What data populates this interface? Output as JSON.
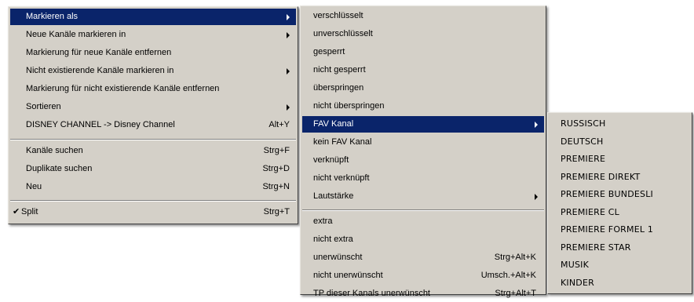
{
  "menu_main": {
    "items": [
      {
        "label": "Markieren als"
      },
      {
        "label": "Neue Kanäle markieren in"
      },
      {
        "label": "Markierung für neue Kanäle entfernen"
      },
      {
        "label": "Nicht existierende Kanäle markieren in"
      },
      {
        "label": "Markierung für nicht existierende Kanäle entfernen"
      },
      {
        "label": "Sortieren"
      },
      {
        "label": "DISNEY CHANNEL -> Disney Channel",
        "shortcut": "Alt+Y"
      },
      {
        "label": "Kanäle suchen",
        "shortcut": "Strg+F"
      },
      {
        "label": "Duplikate suchen",
        "shortcut": "Strg+D"
      },
      {
        "label": "Neu",
        "shortcut": "Strg+N"
      },
      {
        "label": "Split",
        "shortcut": "Strg+T",
        "check": "✔"
      }
    ]
  },
  "menu_markieren": {
    "items": [
      {
        "label": "verschlüsselt"
      },
      {
        "label": "unverschlüsselt"
      },
      {
        "label": "gesperrt"
      },
      {
        "label": "nicht gesperrt"
      },
      {
        "label": "überspringen"
      },
      {
        "label": "nicht überspringen"
      },
      {
        "label": "FAV Kanal"
      },
      {
        "label": "kein FAV Kanal"
      },
      {
        "label": "verknüpft"
      },
      {
        "label": "nicht verknüpft"
      },
      {
        "label": "Lautstärke"
      },
      {
        "label": "extra"
      },
      {
        "label": "nicht extra"
      },
      {
        "label": "unerwünscht",
        "shortcut": "Strg+Alt+K"
      },
      {
        "label": "nicht unerwünscht",
        "shortcut": "Umsch.+Alt+K"
      },
      {
        "label": "TP dieser Kanals unerwünscht",
        "shortcut": "Strg+Alt+T"
      }
    ]
  },
  "menu_fav": {
    "items": [
      {
        "label": "RUSSISCH"
      },
      {
        "label": "DEUTSCH"
      },
      {
        "label": "PREMIERE"
      },
      {
        "label": "PREMIERE DIREKT"
      },
      {
        "label": "PREMIERE BUNDESLI"
      },
      {
        "label": "PREMIERE CL"
      },
      {
        "label": "PREMIERE FORMEL 1"
      },
      {
        "label": "PREMIERE STAR"
      },
      {
        "label": "MUSIK"
      },
      {
        "label": "KINDER"
      }
    ]
  },
  "colors": {
    "menu_bg": "#d4d0c8",
    "highlight": "#0a246a",
    "highlight_text": "#ffffff"
  }
}
